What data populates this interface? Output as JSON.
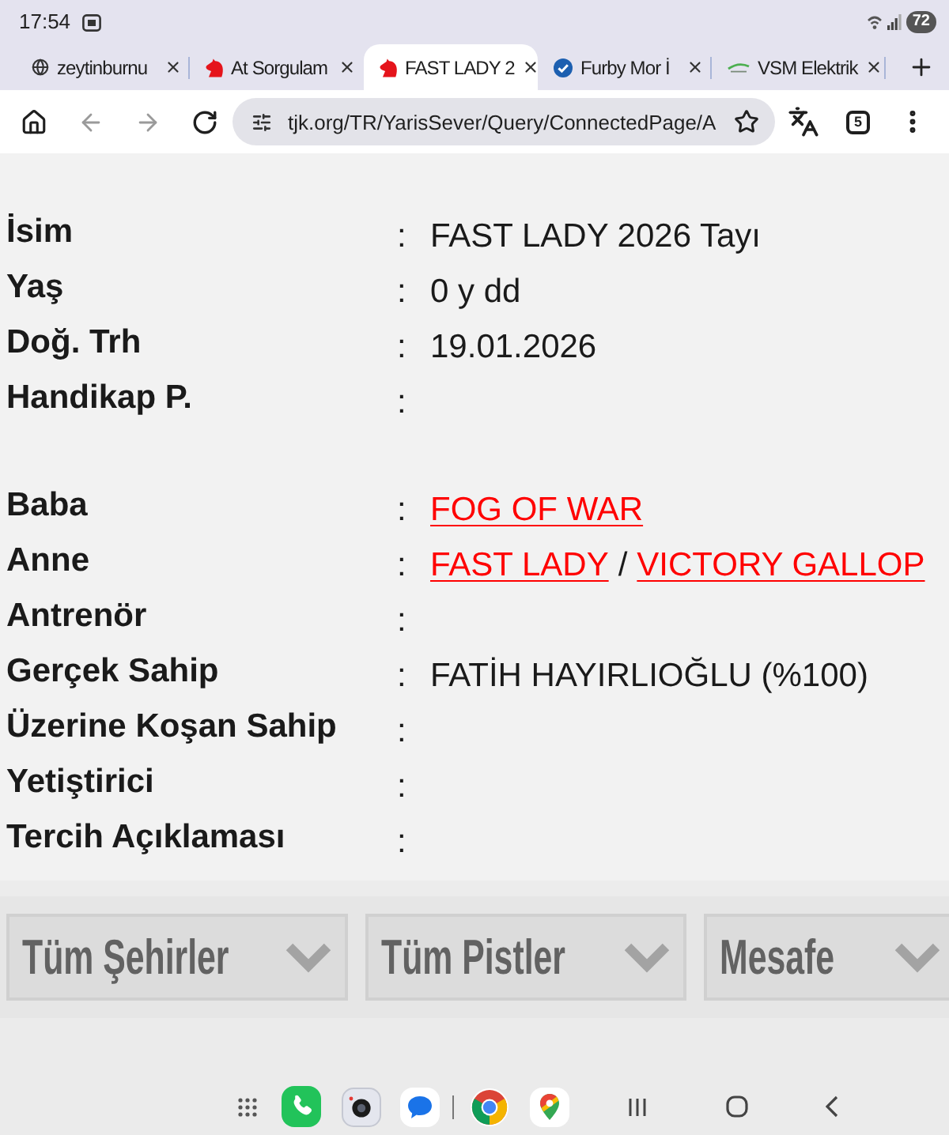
{
  "status_bar": {
    "time": "17:54",
    "battery": "72"
  },
  "tabs": [
    {
      "title": "zeytinburnu",
      "kind": "globe",
      "selected": false
    },
    {
      "title": "At Sorgulam",
      "kind": "horse",
      "selected": false
    },
    {
      "title": "FAST LADY 2",
      "kind": "horse",
      "selected": true
    },
    {
      "title": "Furby Mor İ",
      "kind": "check",
      "selected": false
    },
    {
      "title": "VSM Elektrik",
      "kind": "swoosh",
      "selected": false
    }
  ],
  "toolbar": {
    "back_disabled": true,
    "forward_disabled": true,
    "url": "tjk.org/TR/YarisSever/Query/ConnectedPage/A",
    "tab_count": "5"
  },
  "details": [
    {
      "rows": [
        {
          "label": "İsim",
          "separator": ":",
          "value": [
            {
              "kind": "text",
              "text": "FAST LADY 2026 Tayı"
            }
          ]
        },
        {
          "label": "Yaş",
          "separator": ":",
          "value": [
            {
              "kind": "text",
              "text": "0 y dd"
            }
          ]
        },
        {
          "label": "Doğ. Trh",
          "separator": ":",
          "value": [
            {
              "kind": "text",
              "text": "19.01.2026"
            }
          ]
        },
        {
          "label": "Handikap P.",
          "separator": ":"
        }
      ]
    },
    {
      "rows": [
        {
          "label": "Baba",
          "separator": ":",
          "value": [
            {
              "kind": "link",
              "text": "FOG OF WAR"
            }
          ]
        },
        {
          "label": "Anne",
          "separator": ":",
          "value": [
            {
              "kind": "link",
              "text": "FAST LADY"
            },
            {
              "kind": "separator",
              "text": "/"
            },
            {
              "kind": "link",
              "text": "VICTORY GALLOP"
            }
          ]
        },
        {
          "label": "Antrenör",
          "separator": ":"
        },
        {
          "label": "Gerçek Sahip",
          "separator": ":",
          "value": [
            {
              "kind": "text",
              "text": "FATİH HAYIRLIOĞLU (%100)"
            }
          ]
        },
        {
          "label": "Üzerine Koşan Sahip",
          "separator": ":"
        },
        {
          "label": "Yetiştirici",
          "separator": ":"
        },
        {
          "label": "Tercih Açıklaması",
          "separator": ":"
        }
      ]
    }
  ],
  "filters": [
    {
      "label": "Tüm Şehirler"
    },
    {
      "label": "Tüm Pistler"
    },
    {
      "label": "Mesafe"
    }
  ]
}
